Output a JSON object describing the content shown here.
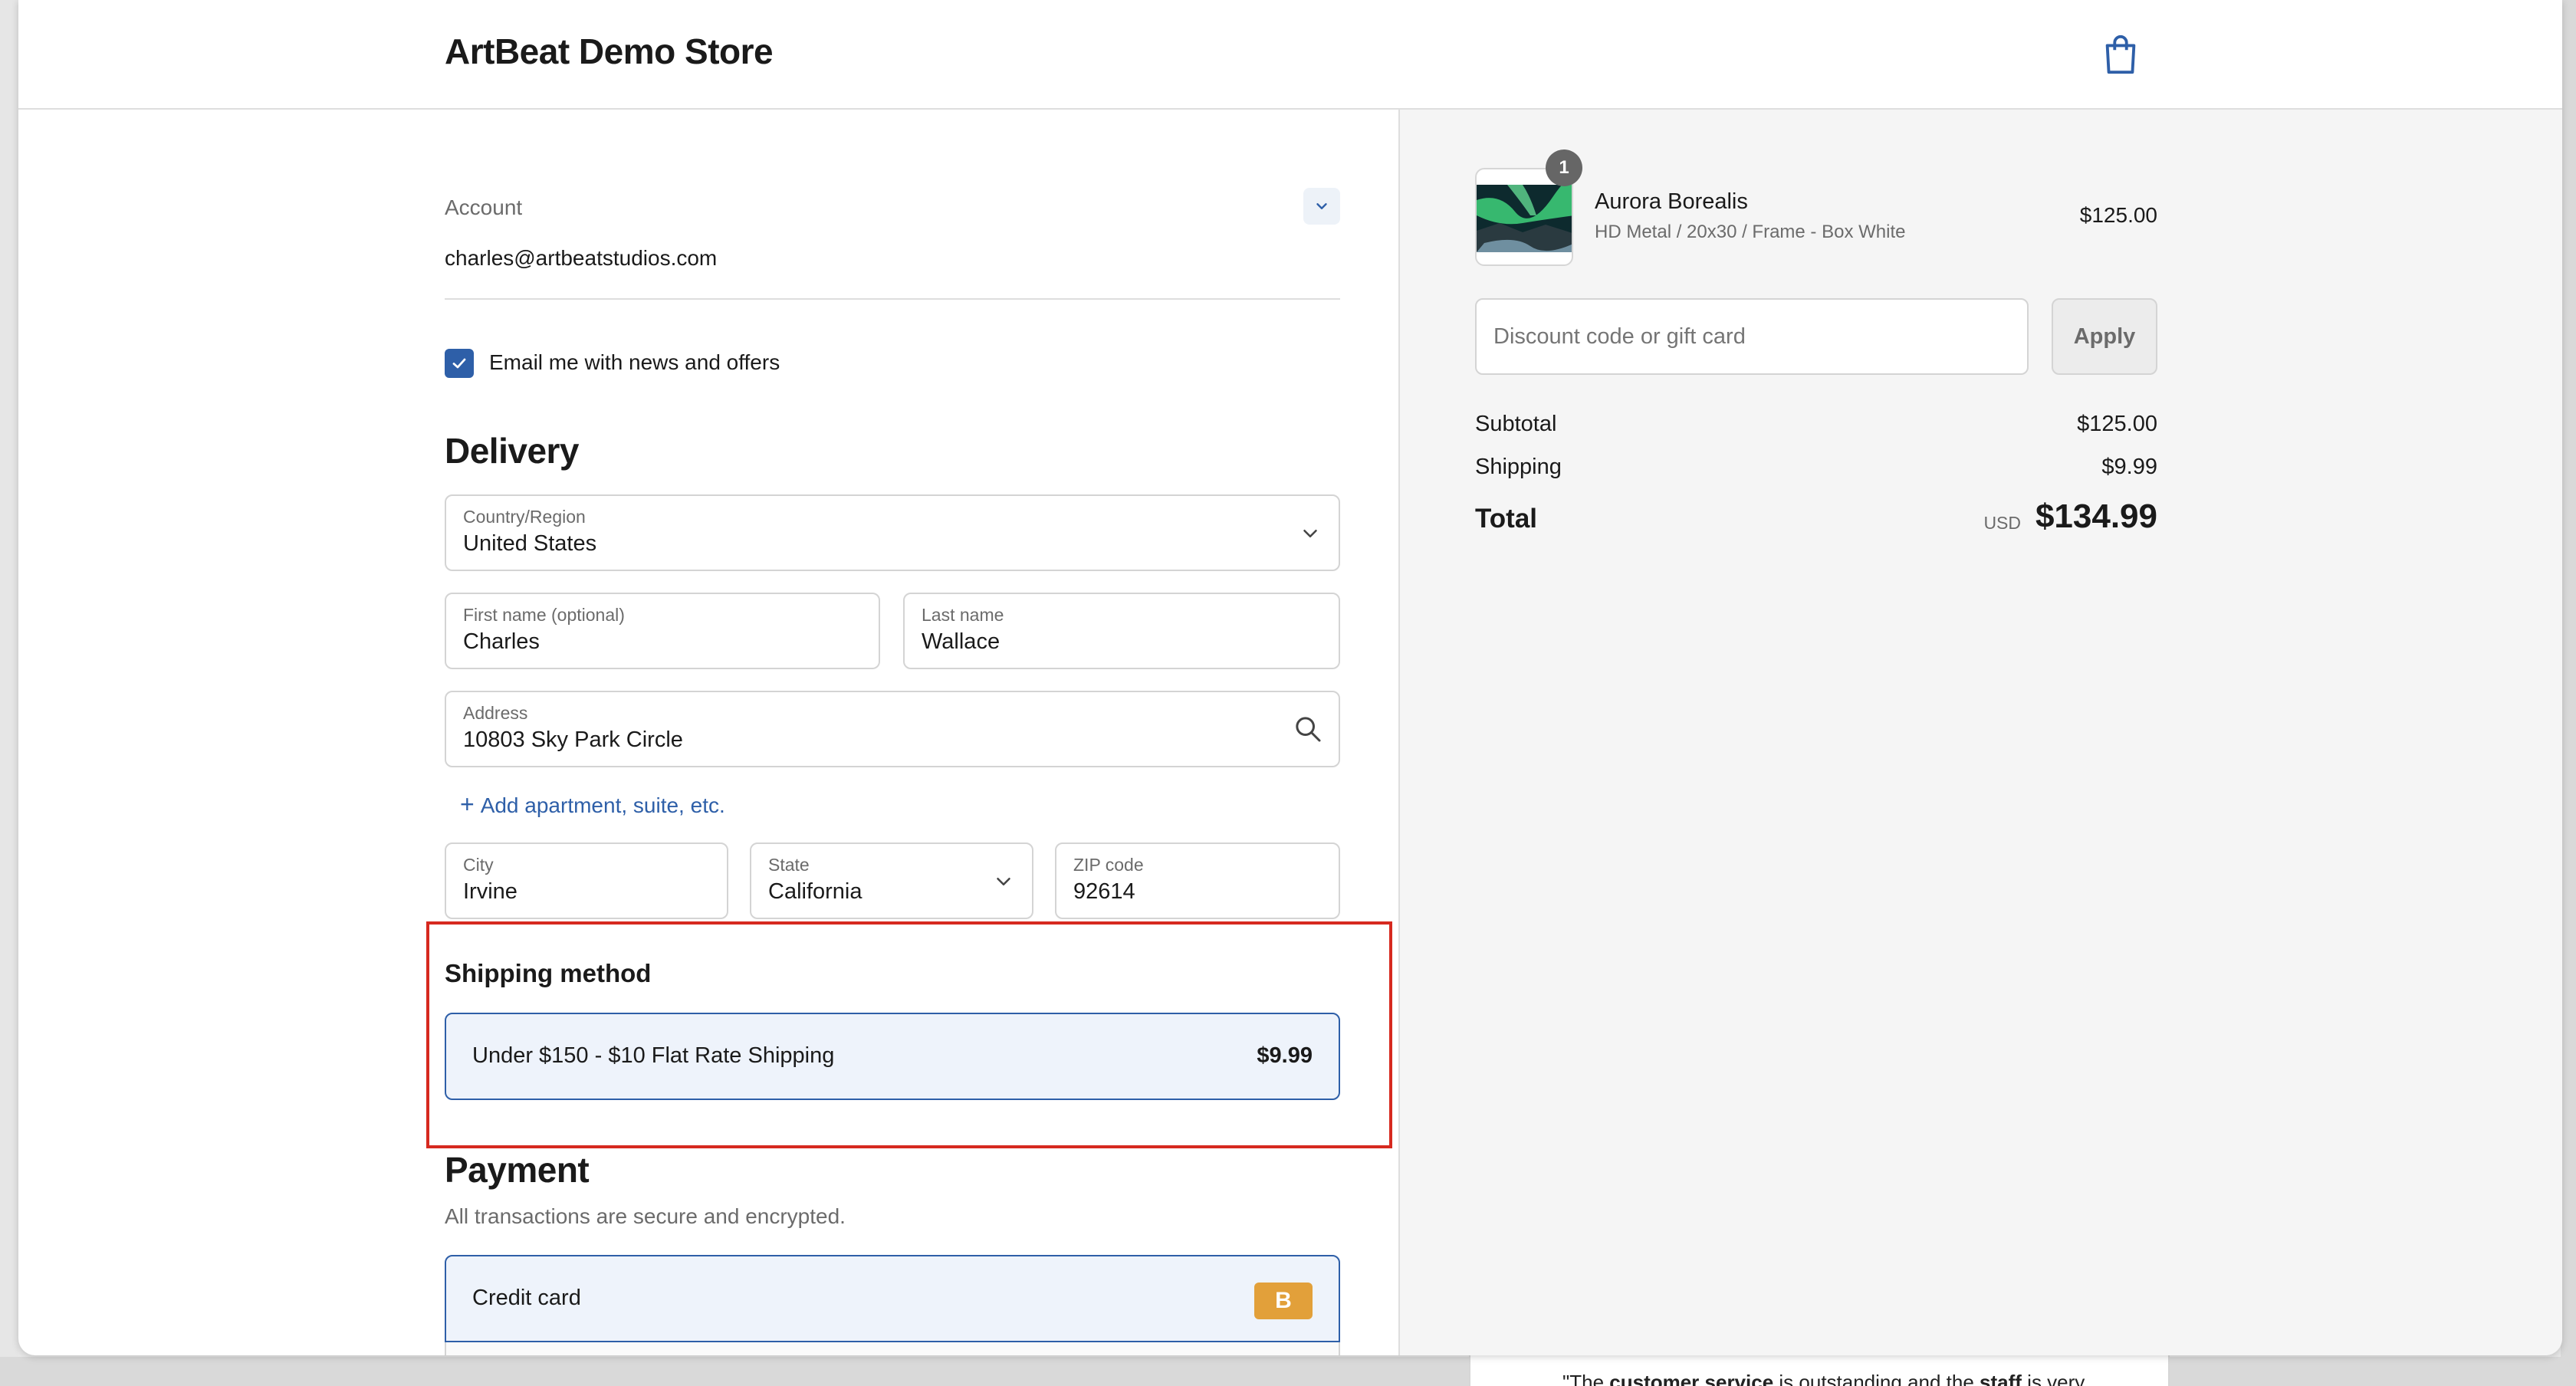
{
  "store": {
    "name": "ArtBeat Demo Store"
  },
  "account": {
    "label": "Account",
    "email": "charles@artbeatstudios.com",
    "newsletter_label": "Email me with news and offers",
    "newsletter_checked": true
  },
  "delivery": {
    "title": "Delivery",
    "country": {
      "label": "Country/Region",
      "value": "United States"
    },
    "first_name": {
      "label": "First name (optional)",
      "value": "Charles"
    },
    "last_name": {
      "label": "Last name",
      "value": "Wallace"
    },
    "address": {
      "label": "Address",
      "value": "10803 Sky Park Circle"
    },
    "add_apartment": "Add apartment, suite, etc.",
    "city": {
      "label": "City",
      "value": "Irvine"
    },
    "state": {
      "label": "State",
      "value": "California"
    },
    "zip": {
      "label": "ZIP code",
      "value": "92614"
    }
  },
  "shipping": {
    "title": "Shipping method",
    "option_name": "Under $150 - $10 Flat Rate Shipping",
    "option_price": "$9.99"
  },
  "payment": {
    "title": "Payment",
    "subtitle": "All transactions are secure and encrypted.",
    "method": "Credit card",
    "badge": "B"
  },
  "summary": {
    "item": {
      "qty": "1",
      "name": "Aurora Borealis",
      "variant": "HD Metal / 20x30 / Frame - Box White",
      "price": "$125.00"
    },
    "discount_placeholder": "Discount code or gift card",
    "apply_label": "Apply",
    "subtotal_label": "Subtotal",
    "subtotal": "$125.00",
    "shipping_label": "Shipping",
    "shipping": "$9.99",
    "total_label": "Total",
    "currency": "USD",
    "total": "$134.99"
  },
  "background_review": {
    "prefix": "\"The ",
    "b1": "customer service",
    "mid": " is outstanding and the ",
    "b2": "staff",
    "suffix": " is very"
  },
  "colors": {
    "accent": "#2e5fa8",
    "highlight_border": "#d6291f",
    "badge": "#e2a03a"
  }
}
